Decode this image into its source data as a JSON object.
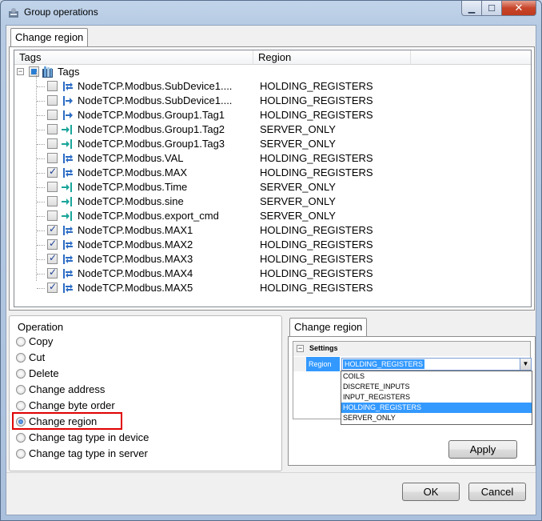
{
  "window": {
    "title": "Group operations",
    "controls": {
      "minimize": "▁",
      "maximize": "☐",
      "close": "✕"
    }
  },
  "top_tab": {
    "label": "Change region"
  },
  "tree": {
    "columns": {
      "tags": "Tags",
      "region": "Region"
    },
    "root_label": "Tags",
    "rows": [
      {
        "name": "NodeTCP.Modbus.SubDevice1....",
        "region": "HOLDING_REGISTERS",
        "checked": false,
        "icon": "bidirectional-tag-icon"
      },
      {
        "name": "NodeTCP.Modbus.SubDevice1....",
        "region": "HOLDING_REGISTERS",
        "checked": false,
        "icon": "input-tag-icon"
      },
      {
        "name": "NodeTCP.Modbus.Group1.Tag1",
        "region": "HOLDING_REGISTERS",
        "checked": false,
        "icon": "input-tag-icon"
      },
      {
        "name": "NodeTCP.Modbus.Group1.Tag2",
        "region": "SERVER_ONLY",
        "checked": false,
        "icon": "server-tag-icon"
      },
      {
        "name": "NodeTCP.Modbus.Group1.Tag3",
        "region": "SERVER_ONLY",
        "checked": false,
        "icon": "server-tag-icon"
      },
      {
        "name": "NodeTCP.Modbus.VAL",
        "region": "HOLDING_REGISTERS",
        "checked": false,
        "icon": "bidirectional-tag-icon"
      },
      {
        "name": "NodeTCP.Modbus.MAX",
        "region": "HOLDING_REGISTERS",
        "checked": true,
        "icon": "bidirectional-tag-icon"
      },
      {
        "name": "NodeTCP.Modbus.Time",
        "region": "SERVER_ONLY",
        "checked": false,
        "icon": "server-tag-icon"
      },
      {
        "name": "NodeTCP.Modbus.sine",
        "region": "SERVER_ONLY",
        "checked": false,
        "icon": "server-tag-icon"
      },
      {
        "name": "NodeTCP.Modbus.export_cmd",
        "region": "SERVER_ONLY",
        "checked": false,
        "icon": "server-tag-icon"
      },
      {
        "name": "NodeTCP.Modbus.MAX1",
        "region": "HOLDING_REGISTERS",
        "checked": true,
        "icon": "bidirectional-tag-icon"
      },
      {
        "name": "NodeTCP.Modbus.MAX2",
        "region": "HOLDING_REGISTERS",
        "checked": true,
        "icon": "bidirectional-tag-icon"
      },
      {
        "name": "NodeTCP.Modbus.MAX3",
        "region": "HOLDING_REGISTERS",
        "checked": true,
        "icon": "bidirectional-tag-icon"
      },
      {
        "name": "NodeTCP.Modbus.MAX4",
        "region": "HOLDING_REGISTERS",
        "checked": true,
        "icon": "bidirectional-tag-icon"
      },
      {
        "name": "NodeTCP.Modbus.MAX5",
        "region": "HOLDING_REGISTERS",
        "checked": true,
        "icon": "bidirectional-tag-icon"
      }
    ]
  },
  "operation": {
    "title": "Operation",
    "selected": "Change region",
    "options": [
      "Copy",
      "Cut",
      "Delete",
      "Change address",
      "Change byte order",
      "Change region",
      "Change tag type in device",
      "Change tag type in server"
    ]
  },
  "settings_panel": {
    "tab": "Change region",
    "category": "Settings",
    "property": "Region",
    "value": "HOLDING_REGISTERS",
    "options": [
      "COILS",
      "DISCRETE_INPUTS",
      "INPUT_REGISTERS",
      "HOLDING_REGISTERS",
      "SERVER_ONLY"
    ],
    "apply": "Apply"
  },
  "footer": {
    "ok": "OK",
    "cancel": "Cancel"
  },
  "colors": {
    "highlight": "#e00000",
    "selection": "#3399ff"
  }
}
